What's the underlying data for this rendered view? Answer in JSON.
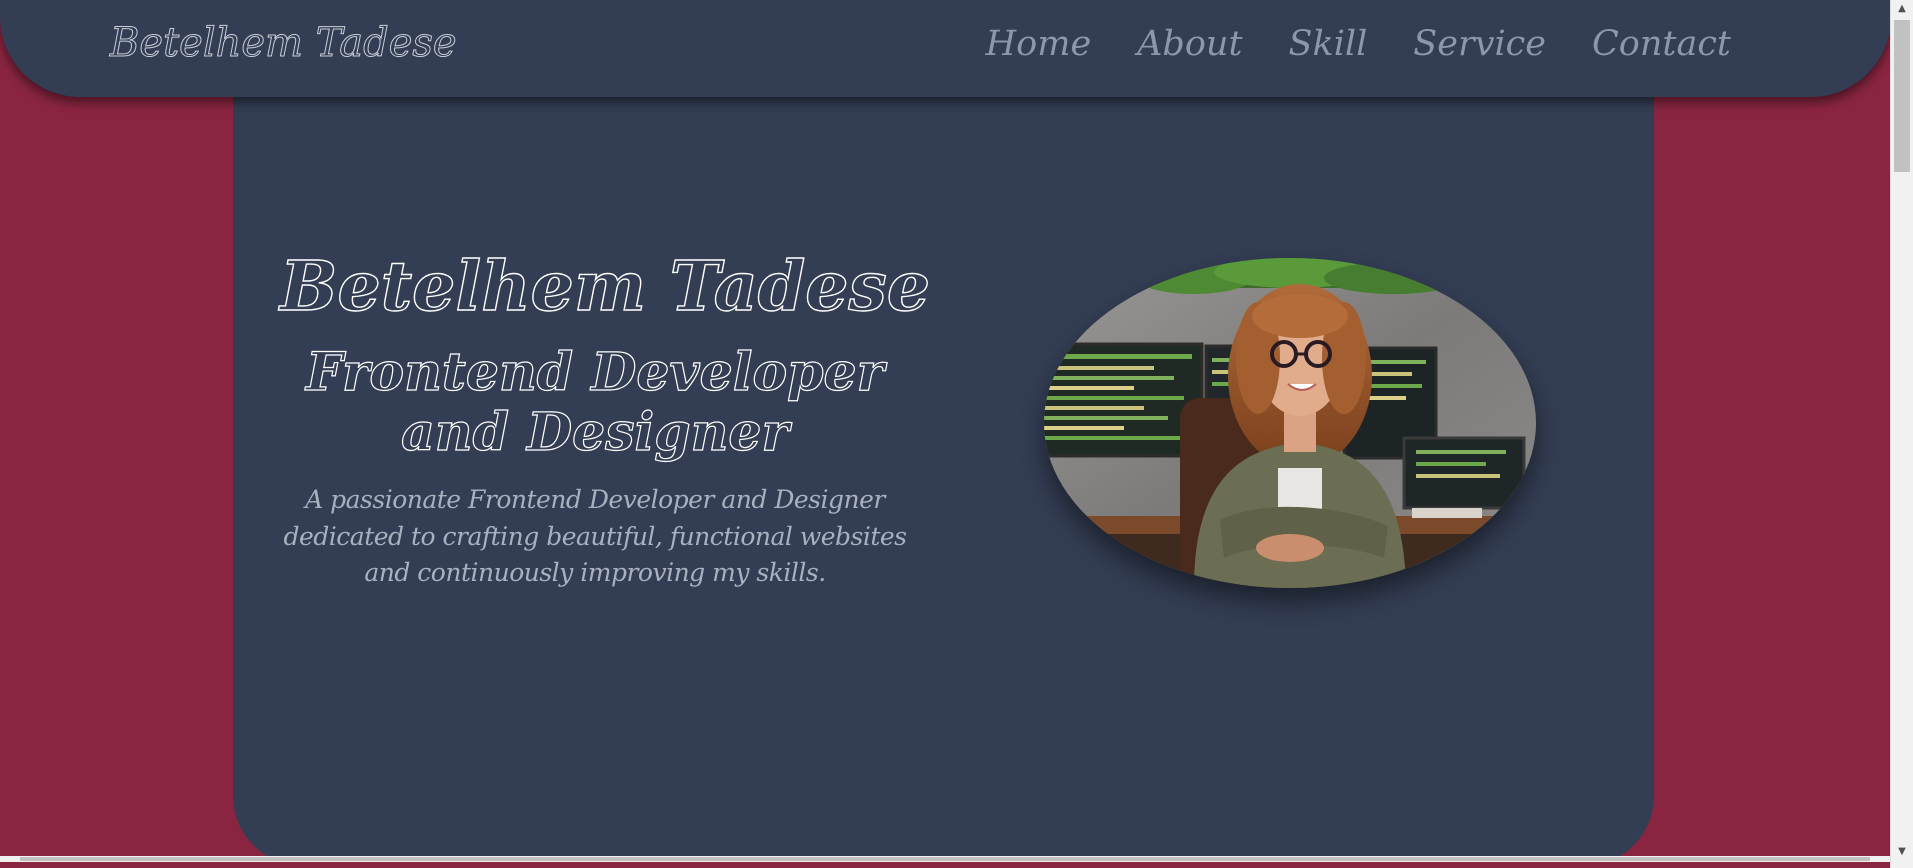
{
  "nav": {
    "brand": "Betelhem Tadese",
    "links": [
      "Home",
      "About",
      "Skill",
      "Service",
      "Contact"
    ]
  },
  "hero": {
    "name": "Betelhem Tadese",
    "role": "Frontend Developer and Designer",
    "description": "A passionate Frontend Developer and Designer dedicated to crafting beautiful, functional websites and continuously improving my skills."
  },
  "colors": {
    "page_background": "#8a2541",
    "panel": "#333d53",
    "nav_link": "#8e97aa",
    "outline_text": "#ffffff"
  },
  "icons": {
    "scroll_up": "triangle-up-icon",
    "scroll_down": "triangle-down-icon"
  }
}
